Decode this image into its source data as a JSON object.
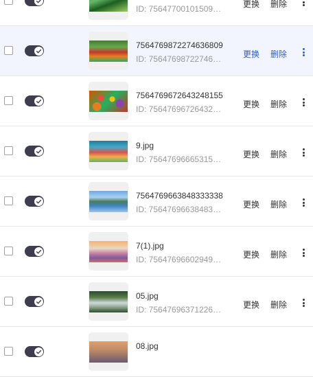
{
  "rows": [
    {
      "name": "",
      "id_text": "ID: 756477001015091...",
      "thumb": "veg-green",
      "thumb_caption": "",
      "toggle_on": true,
      "replace_label": "更换",
      "delete_label": "删除",
      "hover": false
    },
    {
      "name": "7564769872274636809",
      "id_text": "ID: 756476987227463...",
      "thumb": "fruit-stall",
      "thumb_caption": "",
      "toggle_on": true,
      "replace_label": "更换",
      "delete_label": "删除",
      "hover": true
    },
    {
      "name": "7564769672643248155",
      "id_text": "ID: 756476967264324...",
      "thumb": "fruits",
      "thumb_caption": "",
      "toggle_on": true,
      "replace_label": "更换",
      "delete_label": "删除",
      "hover": false
    },
    {
      "name": "9.jpg",
      "id_text": "ID: 756476966653150...",
      "thumb": "banner",
      "thumb_caption": "",
      "toggle_on": true,
      "replace_label": "更换",
      "delete_label": "删除",
      "hover": false
    },
    {
      "name": "7564769663848333338",
      "id_text": "ID: 756476966384833...",
      "thumb": "mountain-lake",
      "thumb_caption": "",
      "toggle_on": true,
      "replace_label": "更换",
      "delete_label": "删除",
      "hover": false
    },
    {
      "name": "7(1).jpg",
      "id_text": "ID: 756476966029492...",
      "thumb": "sunset-clouds",
      "thumb_caption": "",
      "toggle_on": true,
      "replace_label": "更换",
      "delete_label": "删除",
      "hover": false
    },
    {
      "name": "05.jpg",
      "id_text": "ID: 756476963712260...",
      "thumb": "waterfall",
      "thumb_caption": "",
      "toggle_on": true,
      "replace_label": "更换",
      "delete_label": "删除",
      "hover": false
    },
    {
      "name": "08.jpg",
      "id_text": "",
      "thumb": "dusk",
      "thumb_caption": "",
      "toggle_on": true,
      "replace_label": "",
      "delete_label": "",
      "hover": false
    }
  ],
  "colors": {
    "toggle": "#3d3d4f",
    "hover_row": "#f2f5fd",
    "link_active": "#2a5fd0",
    "text": "#333333",
    "muted": "#999999"
  },
  "icons": {
    "toggle_check": "check-icon",
    "more": "more-vertical-icon"
  }
}
